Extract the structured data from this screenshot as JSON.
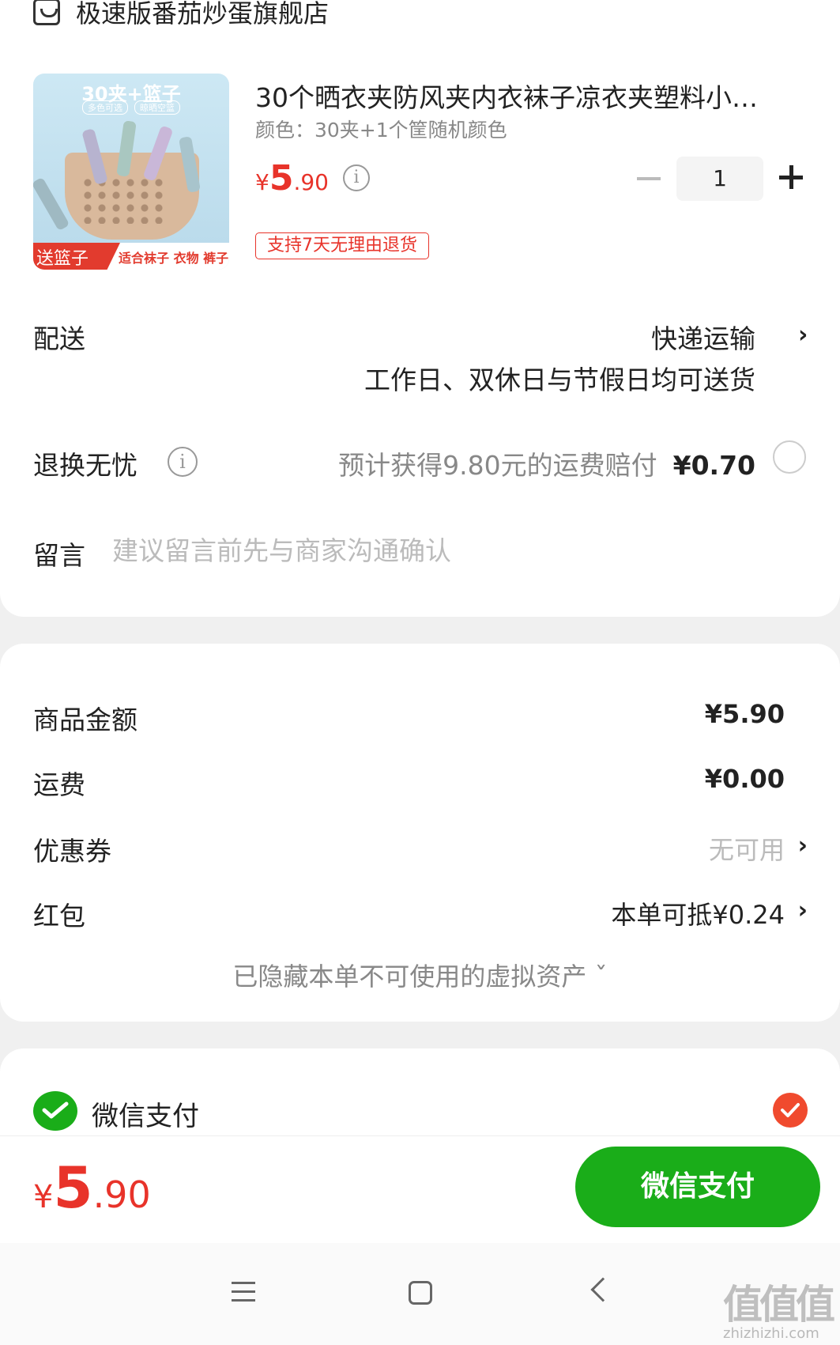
{
  "store": {
    "name": "极速版番茄炒蛋旗舰店",
    "icon": "store-icon"
  },
  "product": {
    "title": "30个晒衣夹防风夹内衣袜子凉衣夹塑料小…",
    "spec": "颜色：30夹+1个筐随机颜色",
    "price_symbol": "¥",
    "price_int": "5",
    "price_dec": ".90",
    "quantity": "1",
    "return_badge": "支持7天无理由退货",
    "image": {
      "headline": "30夹+篮子",
      "tag1": "多色可选",
      "tag2": "晾晒空篮",
      "gift": "送篮子",
      "suitable": "适合袜子 衣物 裤子等等"
    }
  },
  "delivery": {
    "label": "配送",
    "method": "快递运输",
    "note": "工作日、双休日与节假日均可送货"
  },
  "return_insurance": {
    "label": "退换无忧",
    "note": "预计获得9.80元的运费赔付",
    "price": "¥0.70"
  },
  "message": {
    "label": "留言",
    "placeholder": "建议留言前先与商家沟通确认"
  },
  "summary": {
    "goods_label": "商品金额",
    "goods_value": "¥5.90",
    "shipping_label": "运费",
    "shipping_value": "¥0.00",
    "coupon_label": "优惠券",
    "coupon_value": "无可用",
    "redpacket_label": "红包",
    "redpacket_value": "本单可抵¥0.24",
    "hidden_assets": "已隐藏本单不可使用的虚拟资产 ˇ"
  },
  "payment": {
    "method_label": "微信支付"
  },
  "footer": {
    "total_symbol": "¥",
    "total_int": "5",
    "total_dec": ".90",
    "pay_button": "微信支付"
  },
  "watermark": {
    "text": "值值值",
    "sub": "zhizhizhi.com"
  },
  "colors": {
    "accent_red": "#e8332a",
    "wechat_green": "#1aad19",
    "check_red": "#f04a2e"
  }
}
